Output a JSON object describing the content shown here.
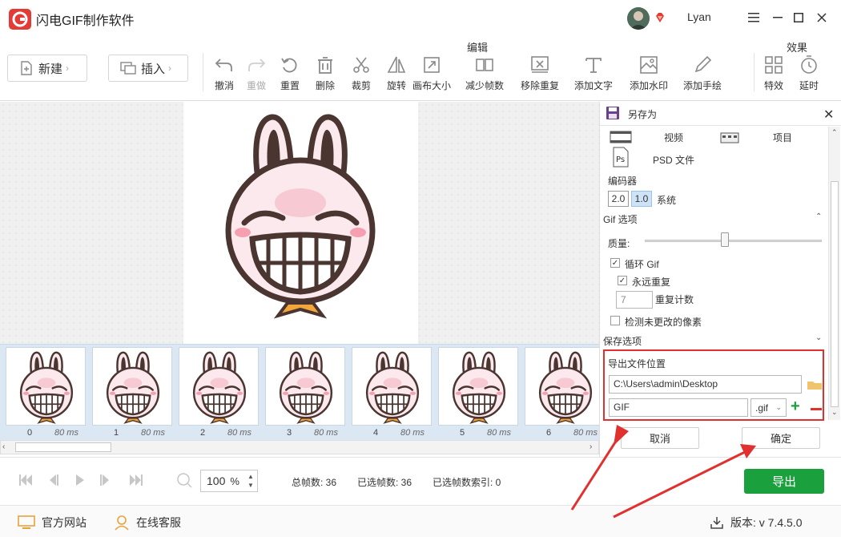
{
  "app": {
    "title": "闪电GIF制作软件",
    "username": "Lyan"
  },
  "toolbar": {
    "new_label": "新建",
    "insert_label": "插入",
    "group_edit": "编辑",
    "group_effects": "效果",
    "tools": [
      {
        "label": "撤消",
        "icon": "undo-icon",
        "enabled": true
      },
      {
        "label": "重做",
        "icon": "redo-icon",
        "enabled": false
      },
      {
        "label": "重置",
        "icon": "reset-icon",
        "enabled": true
      },
      {
        "label": "删除",
        "icon": "delete-icon",
        "enabled": true
      },
      {
        "label": "裁剪",
        "icon": "crop-icon",
        "enabled": true
      },
      {
        "label": "旋转",
        "icon": "rotate-icon",
        "enabled": true
      },
      {
        "label": "画布大小",
        "icon": "canvas-size-icon",
        "enabled": true
      },
      {
        "label": "减少帧数",
        "icon": "reduce-frames-icon",
        "enabled": true
      },
      {
        "label": "移除重复",
        "icon": "remove-duplicates-icon",
        "enabled": true
      },
      {
        "label": "添加文字",
        "icon": "add-text-icon",
        "enabled": true
      },
      {
        "label": "添加水印",
        "icon": "add-watermark-icon",
        "enabled": true
      },
      {
        "label": "添加手绘",
        "icon": "add-drawing-icon",
        "enabled": true
      },
      {
        "label": "特效",
        "icon": "effects-icon",
        "enabled": true
      },
      {
        "label": "延时",
        "icon": "delay-icon",
        "enabled": true
      }
    ]
  },
  "filmstrip": {
    "frames": [
      {
        "index": "0",
        "duration": "80 ms"
      },
      {
        "index": "1",
        "duration": "80 ms"
      },
      {
        "index": "2",
        "duration": "80 ms"
      },
      {
        "index": "3",
        "duration": "80 ms"
      },
      {
        "index": "4",
        "duration": "80 ms"
      },
      {
        "index": "5",
        "duration": "80 ms"
      },
      {
        "index": "6",
        "duration": "80 ms"
      }
    ]
  },
  "panel": {
    "title": "另存为",
    "format_video": "视频",
    "format_project": "项目",
    "format_psd": "PSD 文件",
    "encoder_label": "编码器",
    "encoder_options": [
      "2.0",
      "1.0",
      "系统"
    ],
    "gif_options_label": "Gif 选项",
    "quality_label": "质量:",
    "quality_level": 0.45,
    "loop_gif": "循环 Gif",
    "repeat_forever": "永远重复",
    "repeat_count_value": "7",
    "repeat_count_label": "重复计数",
    "detect_unchanged": "检测未更改的像素",
    "save_options_label": "保存选项",
    "export_location_label": "导出文件位置",
    "export_path": "C:\\Users\\admin\\Desktop",
    "filename": "GIF",
    "extension": ".gif",
    "cancel_label": "取消",
    "ok_label": "确定"
  },
  "controls": {
    "zoom_value": "100",
    "zoom_unit": "%",
    "total_frames": "总帧数: 36",
    "selected_frames": "已选帧数: 36",
    "selected_index": "已选帧数索引: 0",
    "export_label": "导出"
  },
  "footer": {
    "website": "官方网站",
    "support": "在线客服",
    "version": "版本: v 7.4.5.0"
  },
  "colors": {
    "accent_green": "#1aa03d",
    "highlight_red": "#e0312f",
    "logo_red": "#e33b36"
  }
}
